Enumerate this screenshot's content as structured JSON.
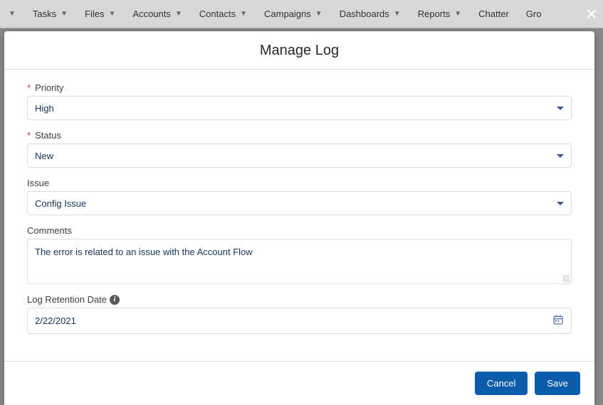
{
  "nav": {
    "items": [
      {
        "label": "Tasks"
      },
      {
        "label": "Files"
      },
      {
        "label": "Accounts"
      },
      {
        "label": "Contacts"
      },
      {
        "label": "Campaigns"
      },
      {
        "label": "Dashboards"
      },
      {
        "label": "Reports"
      },
      {
        "label": "Chatter"
      },
      {
        "label": "Gro"
      }
    ]
  },
  "modal": {
    "title": "Manage Log",
    "fields": {
      "priority": {
        "label": "Priority",
        "value": "High",
        "required": true
      },
      "status": {
        "label": "Status",
        "value": "New",
        "required": true
      },
      "issue": {
        "label": "Issue",
        "value": "Config Issue",
        "required": false
      },
      "comments": {
        "label": "Comments",
        "value": "The error is related to an issue with the Account Flow"
      },
      "retention": {
        "label": "Log Retention Date",
        "value": "2/22/2021"
      }
    },
    "buttons": {
      "cancel": "Cancel",
      "save": "Save"
    }
  }
}
